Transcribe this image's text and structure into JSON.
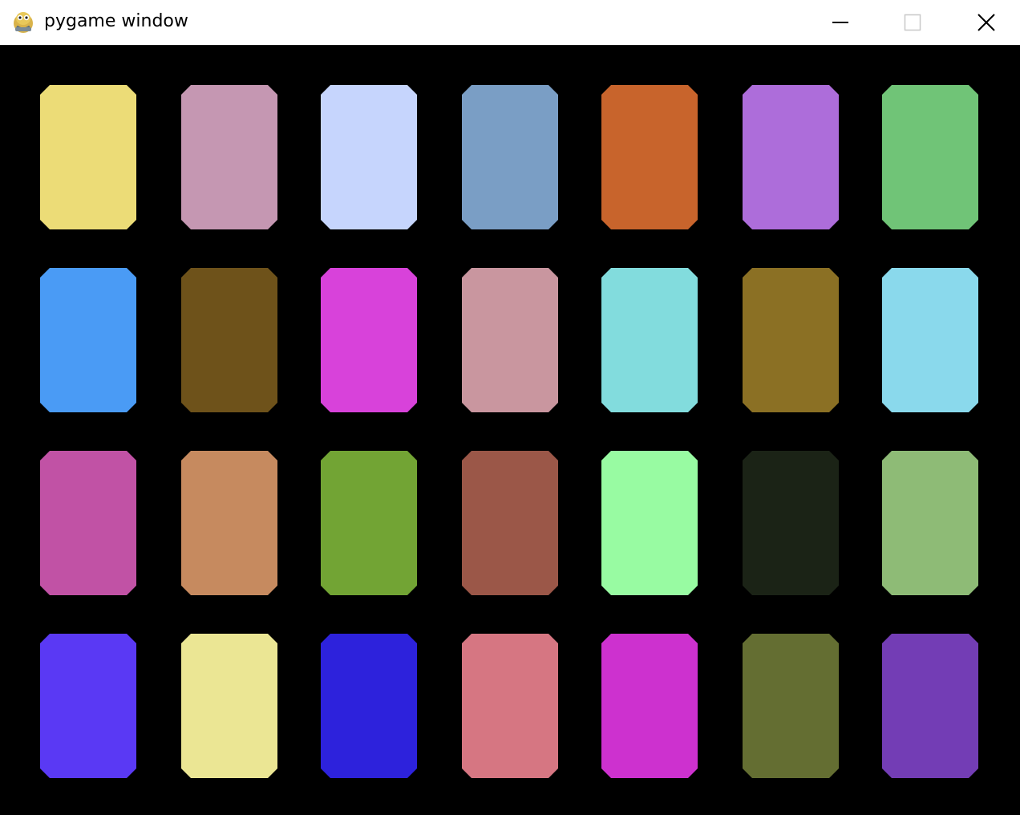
{
  "window": {
    "title": "pygame window",
    "icon": "pygame-snake-icon",
    "controls": {
      "minimize_icon": "minimize-icon",
      "maximize_icon": "maximize-icon",
      "close_icon": "close-icon"
    }
  },
  "board": {
    "background": "#000000",
    "rows": 4,
    "columns": 7,
    "cards": [
      [
        "#ecdc77",
        "#c597b2",
        "#c6d5fd",
        "#7a9ec5",
        "#c8642c",
        "#ad6dda",
        "#70c477"
      ],
      [
        "#4a9bf5",
        "#6e521a",
        "#d842da",
        "#c9969f",
        "#82dcdd",
        "#8b7024",
        "#8ad9ec"
      ],
      [
        "#c152a5",
        "#c68a5f",
        "#72a434",
        "#9b5748",
        "#98fba2",
        "#1b2316",
        "#8ebb76"
      ],
      [
        "#5a39f4",
        "#ebe694",
        "#2d22dc",
        "#d67682",
        "#cd31cf",
        "#646e32",
        "#733db5"
      ]
    ]
  }
}
